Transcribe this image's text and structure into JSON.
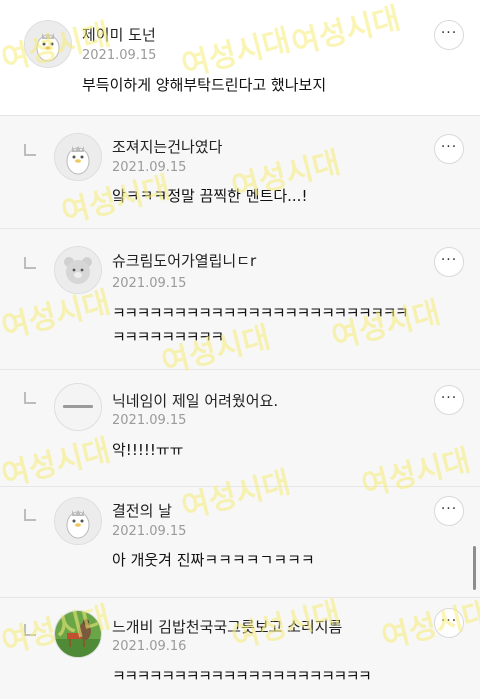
{
  "watermark": "여성시대",
  "comments": [
    {
      "name": "제이미 도넌",
      "date": "2021.09.15",
      "body": "부득이하게 양해부탁드린다고 했나보지",
      "avatar": "penguin-avatar"
    },
    {
      "name": "조져지는건나였다",
      "date": "2021.09.15",
      "body": "앜ㅋㅋㅋ정말 끔찍한 멘트다...!",
      "avatar": "penguin-avatar"
    },
    {
      "name": "슈크림도어가열립니ㄷr",
      "date": "2021.09.15",
      "line1": "ㅋㅋㅋㅋㅋㅋㅋㅋㅋㅋㅋㅋㅋㅋㅋㅋㅋㅋㅋㅋㅋㅋㅋㅋ",
      "line2": "ㅋㅋㅋㅋㅋㅋㅋㅋㅋ",
      "avatar": "bear-avatar"
    },
    {
      "name": "닉네임이 제일 어려웠어요.",
      "date": "2021.09.15",
      "body": "악!!!!!ㅠㅠ",
      "avatar": "wordmark-avatar"
    },
    {
      "name": "결전의 날",
      "date": "2021.09.15",
      "body": "아 개웃겨 진짜ㅋㅋㅋㅋㄱㅋㅋㅋ",
      "avatar": "penguin-avatar"
    },
    {
      "name": "느개비 김밥천국국그릇보고 소리지름",
      "date": "2021.09.16",
      "body": "ㅋㅋㅋㅋㅋㅋㅋㅋㅋㅋㅋㅋㅋㅋㅋㅋㅋㅋㅋㅋㅋ",
      "avatar": "photo-avatar"
    }
  ],
  "more_label": "···",
  "colors": {
    "reply_bg": "#f7f7f7",
    "divider": "#e6e6e6",
    "watermark": "#f5ec78"
  }
}
